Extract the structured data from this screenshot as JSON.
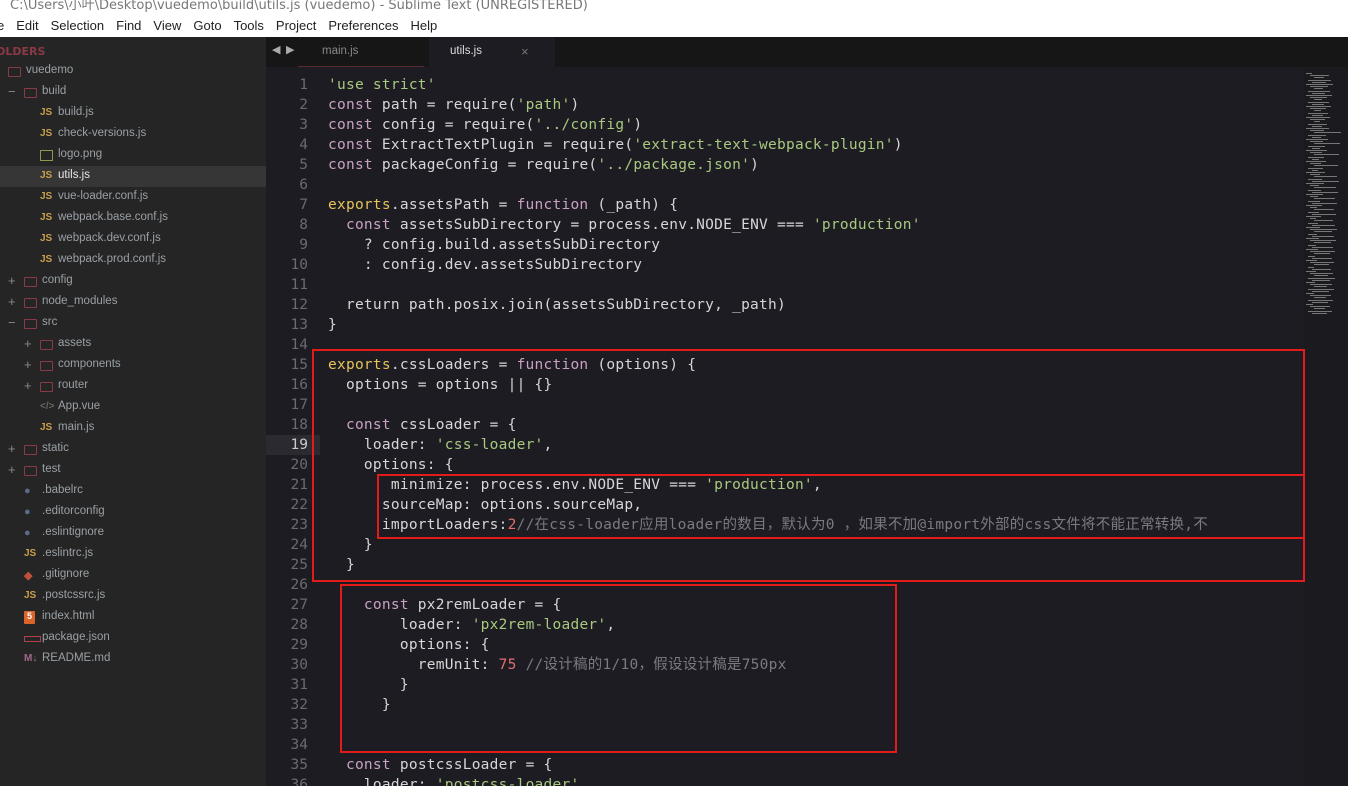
{
  "window": {
    "title": "C:\\Users\\小叶\\Desktop\\vuedemo\\build\\utils.js (vuedemo) - Sublime Text (UNREGISTERED)"
  },
  "menu": [
    "e",
    "Edit",
    "Selection",
    "Find",
    "View",
    "Goto",
    "Tools",
    "Project",
    "Preferences",
    "Help"
  ],
  "sidebar": {
    "header": "OLDERS",
    "items": [
      {
        "label": "vuedemo",
        "icon": "folder-open",
        "toggle": "−",
        "level": 0
      },
      {
        "label": "build",
        "icon": "folder-open",
        "toggle": "−",
        "level": 1
      },
      {
        "label": "build.js",
        "icon": "js",
        "level": 2
      },
      {
        "label": "check-versions.js",
        "icon": "js",
        "level": 2
      },
      {
        "label": "logo.png",
        "icon": "image",
        "level": 2
      },
      {
        "label": "utils.js",
        "icon": "js",
        "level": 2,
        "selected": true
      },
      {
        "label": "vue-loader.conf.js",
        "icon": "js",
        "level": 2
      },
      {
        "label": "webpack.base.conf.js",
        "icon": "js",
        "level": 2
      },
      {
        "label": "webpack.dev.conf.js",
        "icon": "js",
        "level": 2
      },
      {
        "label": "webpack.prod.conf.js",
        "icon": "js",
        "level": 2
      },
      {
        "label": "config",
        "icon": "folder",
        "toggle": "+",
        "level": 1
      },
      {
        "label": "node_modules",
        "icon": "folder",
        "toggle": "+",
        "level": 1
      },
      {
        "label": "src",
        "icon": "folder-open",
        "toggle": "−",
        "level": 1
      },
      {
        "label": "assets",
        "icon": "folder",
        "toggle": "+",
        "level": 2
      },
      {
        "label": "components",
        "icon": "folder",
        "toggle": "+",
        "level": 2
      },
      {
        "label": "router",
        "icon": "folder",
        "toggle": "+",
        "level": 2
      },
      {
        "label": "App.vue",
        "icon": "vue",
        "level": 2
      },
      {
        "label": "main.js",
        "icon": "js",
        "level": 2
      },
      {
        "label": "static",
        "icon": "folder",
        "toggle": "+",
        "level": 1
      },
      {
        "label": "test",
        "icon": "folder",
        "toggle": "+",
        "level": 1
      },
      {
        "label": ".babelrc",
        "icon": "config",
        "level": 1
      },
      {
        "label": ".editorconfig",
        "icon": "config",
        "level": 1
      },
      {
        "label": ".eslintignore",
        "icon": "config",
        "level": 1
      },
      {
        "label": ".eslintrc.js",
        "icon": "js",
        "level": 1
      },
      {
        "label": ".gitignore",
        "icon": "git",
        "level": 1
      },
      {
        "label": ".postcssrc.js",
        "icon": "js",
        "level": 1
      },
      {
        "label": "index.html",
        "icon": "html",
        "level": 1
      },
      {
        "label": "package.json",
        "icon": "package",
        "level": 1
      },
      {
        "label": "README.md",
        "icon": "markdown",
        "level": 1
      }
    ]
  },
  "tabs": [
    {
      "label": "main.js",
      "active": false
    },
    {
      "label": "utils.js",
      "active": true,
      "close": "×"
    }
  ],
  "editor": {
    "highlighted_line": 19,
    "lines": [
      [
        [
          "str",
          "'use strict'"
        ]
      ],
      [
        [
          "kw",
          "const"
        ],
        [
          "d",
          " path = require("
        ],
        [
          "str",
          "'path'"
        ],
        [
          "d",
          ")"
        ]
      ],
      [
        [
          "kw",
          "const"
        ],
        [
          "d",
          " config = require("
        ],
        [
          "str",
          "'../config'"
        ],
        [
          "d",
          ")"
        ]
      ],
      [
        [
          "kw",
          "const"
        ],
        [
          "d",
          " ExtractTextPlugin = require("
        ],
        [
          "str",
          "'extract-text-webpack-plugin'"
        ],
        [
          "d",
          ")"
        ]
      ],
      [
        [
          "kw",
          "const"
        ],
        [
          "d",
          " packageConfig = require("
        ],
        [
          "str",
          "'../package.json'"
        ],
        [
          "d",
          ")"
        ]
      ],
      [],
      [
        [
          "ex",
          "exports"
        ],
        [
          "d",
          ".assetsPath = "
        ],
        [
          "kw",
          "function"
        ],
        [
          "d",
          " (_path) {"
        ]
      ],
      [
        [
          "d",
          "  "
        ],
        [
          "kw",
          "const"
        ],
        [
          "d",
          " assetsSubDirectory = process.env.NODE_ENV === "
        ],
        [
          "str",
          "'production'"
        ]
      ],
      [
        [
          "d",
          "    ? config.build.assetsSubDirectory"
        ]
      ],
      [
        [
          "d",
          "    : config.dev.assetsSubDirectory"
        ]
      ],
      [],
      [
        [
          "d",
          "  return path.posix.join(assetsSubDirectory, _path)"
        ]
      ],
      [
        [
          "d",
          "}"
        ]
      ],
      [],
      [
        [
          "ex",
          "exports"
        ],
        [
          "d",
          ".cssLoaders = "
        ],
        [
          "kw",
          "function"
        ],
        [
          "d",
          " (options) {"
        ]
      ],
      [
        [
          "d",
          "  options = options || {}"
        ]
      ],
      [],
      [
        [
          "d",
          "  "
        ],
        [
          "kw",
          "const"
        ],
        [
          "d",
          " cssLoader = {"
        ]
      ],
      [
        [
          "d",
          "    loader: "
        ],
        [
          "str",
          "'css-loader'"
        ],
        [
          "d",
          ","
        ]
      ],
      [
        [
          "d",
          "    options: {"
        ]
      ],
      [
        [
          "d",
          "       minimize: process.env.NODE_ENV === "
        ],
        [
          "str",
          "'production'"
        ],
        [
          "d",
          ","
        ]
      ],
      [
        [
          "d",
          "      sourceMap: options.sourceMap,"
        ]
      ],
      [
        [
          "d",
          "      importLoaders:"
        ],
        [
          "num",
          "2"
        ],
        [
          "cm",
          "//在css-loader应用loader的数目，默认为0 ，如果不加@import外部的css文件将不能正常转换,不"
        ]
      ],
      [
        [
          "d",
          "    }"
        ]
      ],
      [
        [
          "d",
          "  }"
        ]
      ],
      [],
      [
        [
          "d",
          "    "
        ],
        [
          "kw",
          "const"
        ],
        [
          "d",
          " px2remLoader = {"
        ]
      ],
      [
        [
          "d",
          "        loader: "
        ],
        [
          "str",
          "'px2rem-loader'"
        ],
        [
          "d",
          ","
        ]
      ],
      [
        [
          "d",
          "        options: {"
        ]
      ],
      [
        [
          "d",
          "          remUnit: "
        ],
        [
          "num",
          "75"
        ],
        [
          "cm",
          " //设计稿的1/10，假设设计稿是750px"
        ]
      ],
      [
        [
          "d",
          "        }"
        ]
      ],
      [
        [
          "d",
          "      }"
        ]
      ],
      [],
      [],
      [
        [
          "d",
          "  "
        ],
        [
          "kw",
          "const"
        ],
        [
          "d",
          " postcssLoader = {"
        ]
      ],
      [
        [
          "d",
          "    loader: "
        ],
        [
          "str",
          "'postcss-loader'"
        ],
        [
          "d",
          ","
        ]
      ]
    ]
  },
  "colors": {
    "annotation_box": "#e21b1b",
    "keyword": "#c8a2c0",
    "string": "#a8c97f",
    "number": "#e07070",
    "comment": "#7a7a80",
    "exports": "#e6c35a"
  }
}
